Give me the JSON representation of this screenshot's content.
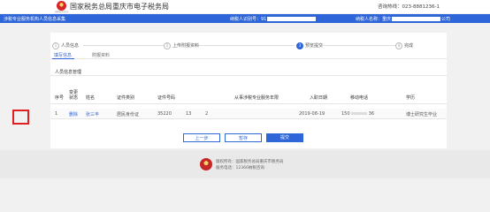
{
  "header": {
    "site_title": "国家税务总局重庆市电子税务局",
    "emblem_caption": "国家税务总局",
    "hotline": "咨询热线：023-8881236-1"
  },
  "infobar": {
    "left": "涉税专业服务机构人员信息采集",
    "taxpayer_label": "纳税人识别号：91",
    "name_label": "纳税人名称：重庆",
    "name_suffix": "公司"
  },
  "steps": [
    {
      "num": "1",
      "label": "人员信息"
    },
    {
      "num": "2",
      "label": "上传附报资料"
    },
    {
      "num": "3",
      "label": "预览提交"
    },
    {
      "num": "4",
      "label": "完成"
    }
  ],
  "tabs": {
    "active": "填写信息",
    "other": "附报资料"
  },
  "section_title": "人员信息管理",
  "table": {
    "headers": {
      "index": "序号",
      "change_status": "变更状态",
      "name": "姓名",
      "id_type": "证件类别",
      "id_number": "证件号码",
      "col_13": "",
      "service_years": "从事涉税专业服务年限",
      "entry_date": "入职日期",
      "mobile": "移动电话",
      "education": "学历"
    },
    "row": {
      "index": "1",
      "change_status": "删除",
      "name": "张三丰",
      "id_type": "居民身份证",
      "id_number": "35220",
      "col_13": "13",
      "service_years": "2",
      "entry_date": "2019-08-19",
      "mobile": "150",
      "mobile_suffix": "36",
      "education": "博士研究生毕业"
    }
  },
  "buttons": {
    "prev": "上一步",
    "save": "暂存",
    "submit": "提交"
  },
  "footer": {
    "copyright": "版权所有：国家税务总局重庆市税务局",
    "hotline": "服务电话：12366纳税咨询"
  },
  "colors": {
    "primary_blue": "#2e65d8",
    "highlight_red": "#e02020"
  }
}
